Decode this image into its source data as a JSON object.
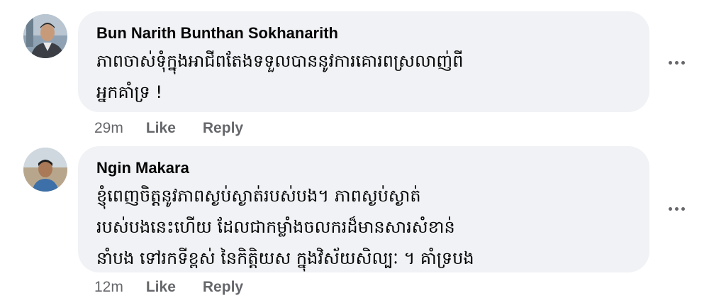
{
  "comments": [
    {
      "author": "Bun Narith Bunthan Sokhanarith",
      "text": "ភាពចាស់ទុំក្នុងអាជីពតែងទទួលបាននូវការគោរពស្រលាញ់ពី\nអ្នកគាំទ្រ !",
      "time": "29m",
      "like_label": "Like",
      "reply_label": "Reply",
      "more_icon": "more-options-icon"
    },
    {
      "author": "Ngin Makara",
      "text": "ខ្ញុំពេញចិត្តនូវភាពស្ងប់ស្ងាត់របស់បង។ ភាពស្ងប់ស្ងាត់\nរបស់បងនេះហើយ ដែលជាកម្លាំងចលករដ៏មានសារសំខាន់\nនាំបង ទៅរកទីខ្ពស់ នៃកិត្តិយស ក្នុងវិស័យសិល្បៈ ។ គាំទ្របង",
      "time": "12m",
      "like_label": "Like",
      "reply_label": "Reply",
      "more_icon": "more-options-icon"
    }
  ]
}
